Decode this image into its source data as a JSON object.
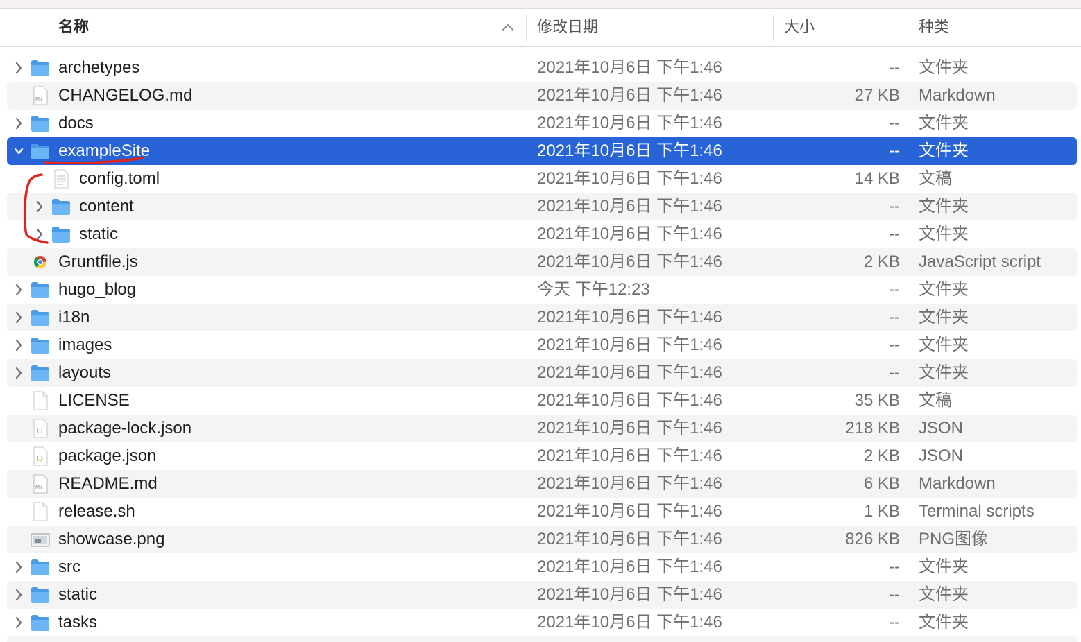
{
  "columns": {
    "name": "名称",
    "date": "修改日期",
    "size": "大小",
    "kind": "种类"
  },
  "rows": [
    {
      "name": "archetypes",
      "date": "2021年10月6日 下午1:46",
      "size": "--",
      "kind": "文件夹",
      "icon": "folder",
      "level": 0,
      "chevron": "right",
      "selected": false
    },
    {
      "name": "CHANGELOG.md",
      "date": "2021年10月6日 下午1:46",
      "size": "27 KB",
      "kind": "Markdown",
      "icon": "markdown",
      "level": 0,
      "chevron": "none",
      "selected": false
    },
    {
      "name": "docs",
      "date": "2021年10月6日 下午1:46",
      "size": "--",
      "kind": "文件夹",
      "icon": "folder",
      "level": 0,
      "chevron": "right",
      "selected": false
    },
    {
      "name": "exampleSite",
      "date": "2021年10月6日 下午1:46",
      "size": "--",
      "kind": "文件夹",
      "icon": "folder",
      "level": 0,
      "chevron": "down",
      "selected": true
    },
    {
      "name": "config.toml",
      "date": "2021年10月6日 下午1:46",
      "size": "14 KB",
      "kind": "文稿",
      "icon": "text",
      "level": 1,
      "chevron": "none",
      "selected": false
    },
    {
      "name": "content",
      "date": "2021年10月6日 下午1:46",
      "size": "--",
      "kind": "文件夹",
      "icon": "folder",
      "level": 1,
      "chevron": "right",
      "selected": false
    },
    {
      "name": "static",
      "date": "2021年10月6日 下午1:46",
      "size": "--",
      "kind": "文件夹",
      "icon": "folder",
      "level": 1,
      "chevron": "right",
      "selected": false
    },
    {
      "name": "Gruntfile.js",
      "date": "2021年10月6日 下午1:46",
      "size": "2 KB",
      "kind": "JavaScript script",
      "icon": "chrome",
      "level": 0,
      "chevron": "none",
      "selected": false
    },
    {
      "name": "hugo_blog",
      "date": "今天 下午12:23",
      "size": "--",
      "kind": "文件夹",
      "icon": "folder",
      "level": 0,
      "chevron": "right",
      "selected": false
    },
    {
      "name": "i18n",
      "date": "2021年10月6日 下午1:46",
      "size": "--",
      "kind": "文件夹",
      "icon": "folder",
      "level": 0,
      "chevron": "right",
      "selected": false
    },
    {
      "name": "images",
      "date": "2021年10月6日 下午1:46",
      "size": "--",
      "kind": "文件夹",
      "icon": "folder",
      "level": 0,
      "chevron": "right",
      "selected": false
    },
    {
      "name": "layouts",
      "date": "2021年10月6日 下午1:46",
      "size": "--",
      "kind": "文件夹",
      "icon": "folder",
      "level": 0,
      "chevron": "right",
      "selected": false
    },
    {
      "name": "LICENSE",
      "date": "2021年10月6日 下午1:46",
      "size": "35 KB",
      "kind": "文稿",
      "icon": "blank",
      "level": 0,
      "chevron": "none",
      "selected": false
    },
    {
      "name": "package-lock.json",
      "date": "2021年10月6日 下午1:46",
      "size": "218 KB",
      "kind": "JSON",
      "icon": "json",
      "level": 0,
      "chevron": "none",
      "selected": false
    },
    {
      "name": "package.json",
      "date": "2021年10月6日 下午1:46",
      "size": "2 KB",
      "kind": "JSON",
      "icon": "json",
      "level": 0,
      "chevron": "none",
      "selected": false
    },
    {
      "name": "README.md",
      "date": "2021年10月6日 下午1:46",
      "size": "6 KB",
      "kind": "Markdown",
      "icon": "markdown",
      "level": 0,
      "chevron": "none",
      "selected": false
    },
    {
      "name": "release.sh",
      "date": "2021年10月6日 下午1:46",
      "size": "1 KB",
      "kind": "Terminal scripts",
      "icon": "blank",
      "level": 0,
      "chevron": "none",
      "selected": false
    },
    {
      "name": "showcase.png",
      "date": "2021年10月6日 下午1:46",
      "size": "826 KB",
      "kind": "PNG图像",
      "icon": "image",
      "level": 0,
      "chevron": "none",
      "selected": false
    },
    {
      "name": "src",
      "date": "2021年10月6日 下午1:46",
      "size": "--",
      "kind": "文件夹",
      "icon": "folder",
      "level": 0,
      "chevron": "right",
      "selected": false
    },
    {
      "name": "static",
      "date": "2021年10月6日 下午1:46",
      "size": "--",
      "kind": "文件夹",
      "icon": "folder",
      "level": 0,
      "chevron": "right",
      "selected": false
    },
    {
      "name": "tasks",
      "date": "2021年10月6日 下午1:46",
      "size": "--",
      "kind": "文件夹",
      "icon": "folder",
      "level": 0,
      "chevron": "right",
      "selected": false
    }
  ],
  "colors": {
    "selection": "#2864d8",
    "folder": "#5aaaf0",
    "annotation": "#e0231c"
  }
}
